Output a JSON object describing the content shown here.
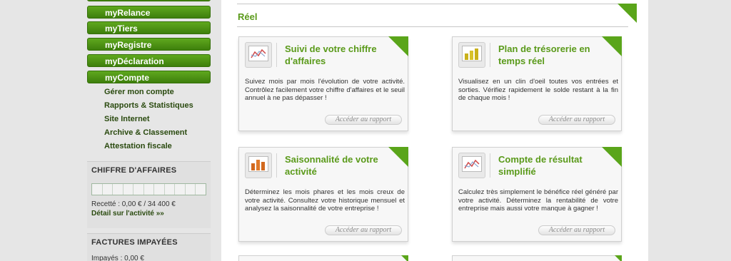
{
  "sidebar": {
    "nav": [
      {
        "label": "myRelance"
      },
      {
        "label": "myTiers"
      },
      {
        "label": "myRegistre"
      },
      {
        "label": "myDéclaration"
      },
      {
        "label": "myCompte"
      }
    ],
    "sub_items": [
      {
        "label": "Gérer mon compte"
      },
      {
        "label": "Rapports & Statistiques"
      },
      {
        "label": "Site Internet"
      },
      {
        "label": "Archive & Classement"
      },
      {
        "label": "Attestation fiscale"
      }
    ],
    "ca_panel": {
      "title": "CHIFFRE D'AFFAIRES",
      "recette": "Recetté : 0,00 € / 34 400 €",
      "detail_link": "Détail sur l'activité »»",
      "progress": 0
    },
    "factures_panel": {
      "title": "FACTURES IMPAYÉES",
      "impayes": "Impayés : 0,00 €"
    }
  },
  "main": {
    "section_title": "Réel",
    "cards": [
      {
        "title": "Suivi de votre chiffre d'affaires",
        "icon": "line-chart-icon",
        "description": "Suivez mois par mois l'évolution de votre activité. Contrôlez facilement votre chiffre d'affaires et le seuil annuel à ne pas dépasser !",
        "button": "Accéder au rapport"
      },
      {
        "title": "Plan de trésorerie en temps réel",
        "icon": "bar-chart-yellow-icon",
        "description": "Visualisez en un clin d'oeil toutes vos entrées et sorties. Vérifiez rapidement le solde restant à la fin de chaque mois !",
        "button": "Accéder au rapport"
      },
      {
        "title": "Saisonnalité de votre activité",
        "icon": "bar-chart-orange-icon",
        "description": "Déterminez les mois phares et les mois creux de votre activité. Consultez votre historique mensuel et analysez la saisonnalité de votre entreprise !",
        "button": "Accéder au rapport"
      },
      {
        "title": "Compte de résultat simplifié",
        "icon": "line-chart-icon",
        "description": "Calculez très simplement le bénéfice réel généré par votre activité. Déterminez la rentabilité de votre entreprise mais aussi votre manque à gagner !",
        "button": "Accéder au rapport"
      }
    ]
  },
  "colors": {
    "accent_green": "#5aa51a",
    "nav_green": "#3e7f0c",
    "title_green": "#5a9a1a"
  }
}
